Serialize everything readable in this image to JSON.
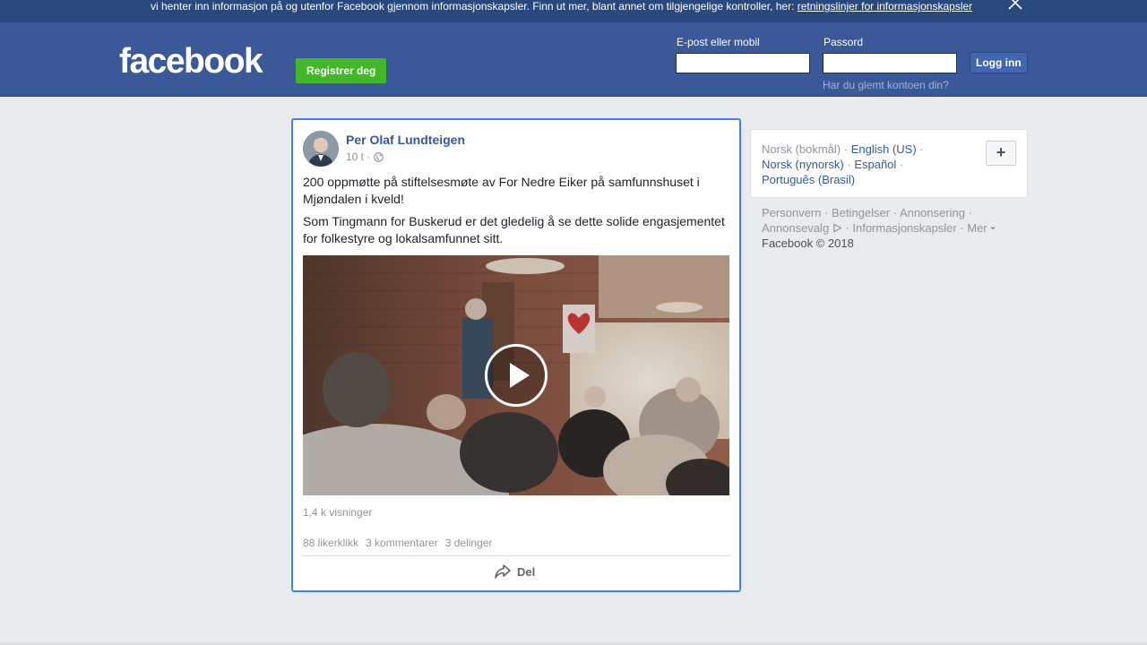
{
  "cookie_banner": {
    "text": "vi henter inn informasjon på og utenfor Facebook gjennom informasjonskapsler. Finn ut mer, blant annet om tilgjengelige kontroller, her: ",
    "link": "retningslinjer for informasjonskapsler",
    "close_icon": "close-icon"
  },
  "header": {
    "logo": "facebook",
    "register": "Registrer deg",
    "email_label": "E-post eller mobil",
    "email_value": "",
    "password_label": "Passord",
    "password_value": "",
    "login": "Logg inn",
    "forgot": "Har du glemt kontoen din?"
  },
  "post": {
    "author": "Per Olaf Lundteigen",
    "time": "10 t ·",
    "privacy_icon": "globe-icon",
    "paragraphs": [
      "200 oppmøtte på stiftelsesmøte av For Nedre Eiker på samfunnshuset i Mjøndalen i kveld!",
      "Som Tingmann for Buskerud er det gledelig å se dette solide engasjementet for folkestyre og lokalsamfunnet sitt."
    ],
    "views": "1,4 k visninger",
    "likes": "88 likerklikk",
    "comments": "3 kommentarer",
    "shares": "3 delinger",
    "share_label": "Del",
    "share_icon": "share-icon"
  },
  "languages": {
    "current": "Norsk (bokmål)",
    "sep": " · ",
    "english": "English (US)",
    "nynorsk": "Norsk (nynorsk)",
    "spanish": "Español",
    "portuguese": "Português (Brasil)",
    "plus": "+"
  },
  "footer": {
    "privacy": "Personvern",
    "terms": "Betingelser",
    "ads": "Annonsering",
    "ad_choices": "Annonsevalg",
    "cookies": "Informasjonskapsler",
    "more": "Mer",
    "copyright": "Facebook © 2018"
  },
  "colors": {
    "brand_blue": "#3b5998",
    "register_green": "#42b72a",
    "link_blue": "#365899",
    "highlight_border": "#4080ff"
  }
}
